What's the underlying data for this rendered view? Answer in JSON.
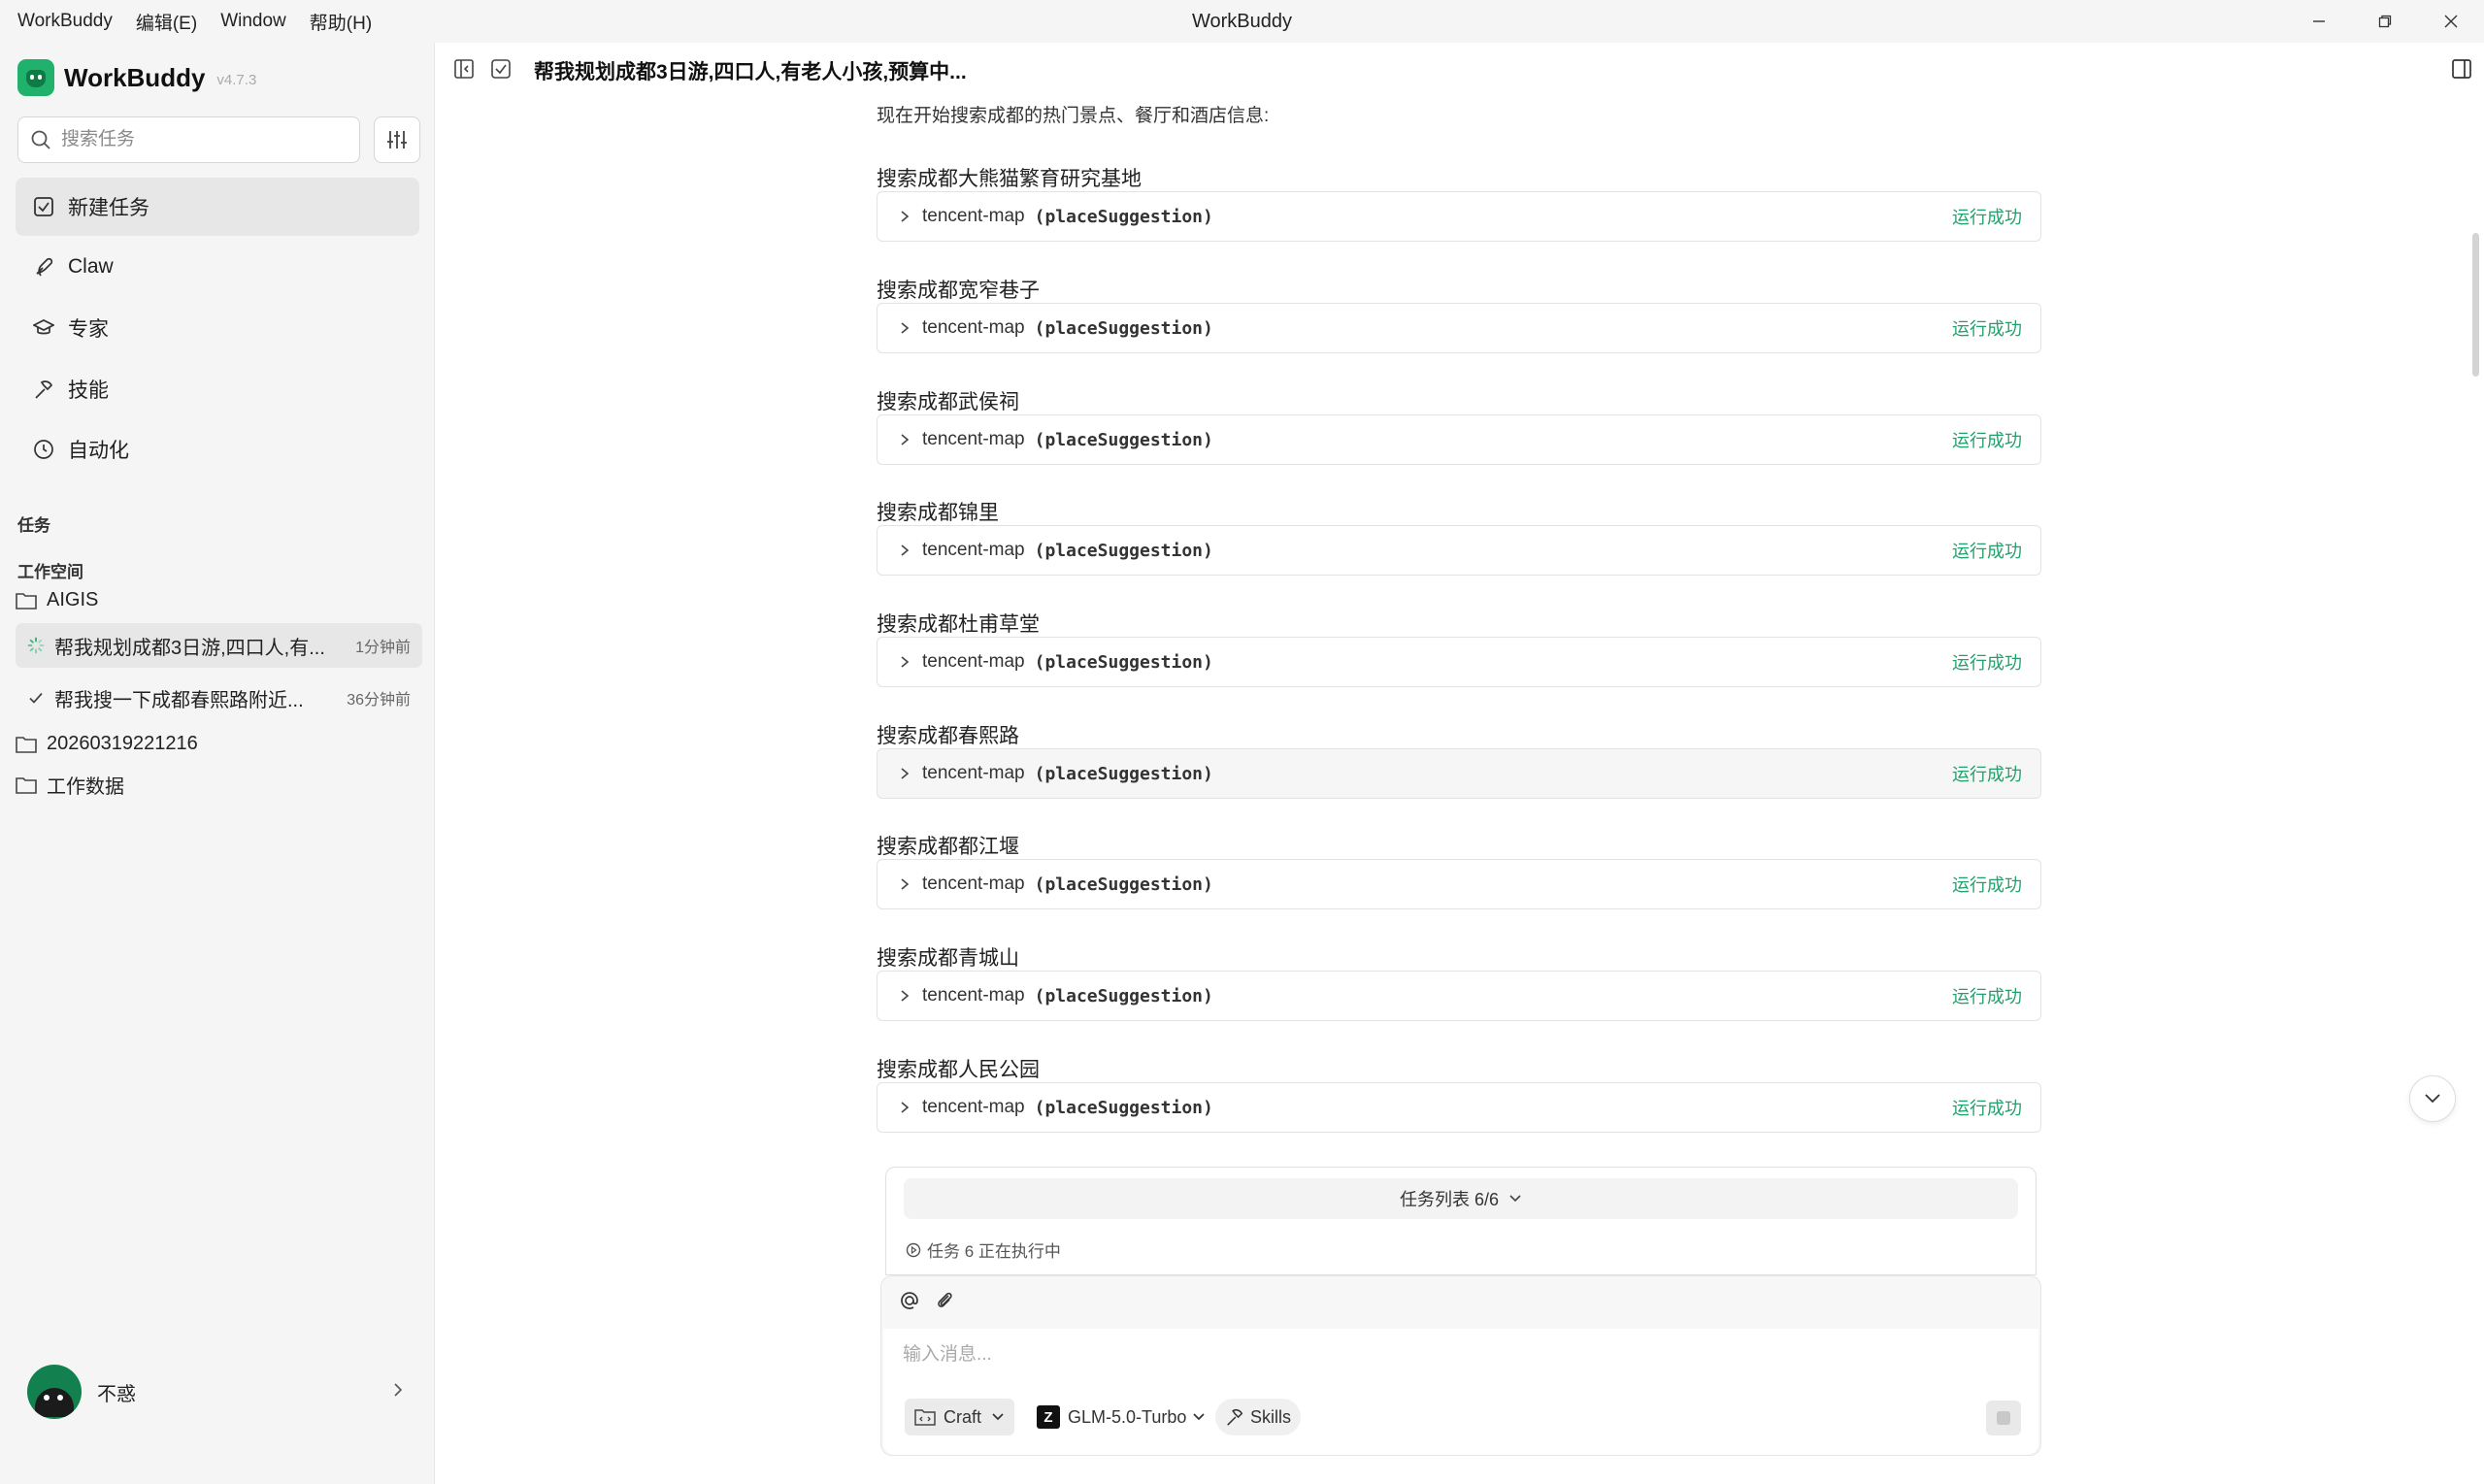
{
  "window": {
    "menu": [
      "WorkBuddy",
      "编辑(E)",
      "Window",
      "帮助(H)"
    ],
    "title": "WorkBuddy"
  },
  "sidebar": {
    "app_name": "WorkBuddy",
    "version": "v4.7.3",
    "search_placeholder": "搜索任务",
    "nav": [
      {
        "label": "新建任务",
        "icon": "new-task-icon"
      },
      {
        "label": "Claw",
        "icon": "claw-icon"
      },
      {
        "label": "专家",
        "icon": "expert-icon"
      },
      {
        "label": "技能",
        "icon": "skills-icon"
      },
      {
        "label": "自动化",
        "icon": "clock-icon"
      }
    ],
    "tasks_heading": "任务",
    "workspace_heading": "工作空间",
    "folders": [
      "AIGIS",
      "20260319221216",
      "工作数据"
    ],
    "tasks": [
      {
        "label": "帮我规划成都3日游,四口人,有...",
        "time": "1分钟前",
        "status": "running"
      },
      {
        "label": "帮我搜一下成都春熙路附近...",
        "time": "36分钟前",
        "status": "done"
      }
    ],
    "user": {
      "name": "不惑"
    }
  },
  "header": {
    "title": "帮我规划成都3日游,四口人,有老人小孩,预算中..."
  },
  "content": {
    "intro": "现在开始搜索成都的热门景点、餐厅和酒店信息:",
    "steps": [
      {
        "title": "搜索成都大熊猫繁育研究基地",
        "tool": "tencent-map",
        "arg": "(placeSuggestion)",
        "status": "运行成功"
      },
      {
        "title": "搜索成都宽窄巷子",
        "tool": "tencent-map",
        "arg": "(placeSuggestion)",
        "status": "运行成功"
      },
      {
        "title": "搜索成都武侯祠",
        "tool": "tencent-map",
        "arg": "(placeSuggestion)",
        "status": "运行成功"
      },
      {
        "title": "搜索成都锦里",
        "tool": "tencent-map",
        "arg": "(placeSuggestion)",
        "status": "运行成功"
      },
      {
        "title": "搜索成都杜甫草堂",
        "tool": "tencent-map",
        "arg": "(placeSuggestion)",
        "status": "运行成功"
      },
      {
        "title": "搜索成都春熙路",
        "tool": "tencent-map",
        "arg": "(placeSuggestion)",
        "status": "运行成功"
      },
      {
        "title": "搜索成都都江堰",
        "tool": "tencent-map",
        "arg": "(placeSuggestion)",
        "status": "运行成功"
      },
      {
        "title": "搜索成都青城山",
        "tool": "tencent-map",
        "arg": "(placeSuggestion)",
        "status": "运行成功"
      },
      {
        "title": "搜索成都人民公园",
        "tool": "tencent-map",
        "arg": "(placeSuggestion)",
        "status": "运行成功"
      }
    ]
  },
  "tasklist": {
    "label": "任务列表 6/6",
    "running": "任务 6 正在执行中"
  },
  "composer": {
    "placeholder": "输入消息...",
    "mode": "Craft",
    "model_logo": "Z",
    "model": "GLM-5.0-Turbo",
    "skills": "Skills"
  },
  "colors": {
    "accent": "#20b26c",
    "success": "#23a06b",
    "sidebar_bg": "#f5f5f5"
  }
}
